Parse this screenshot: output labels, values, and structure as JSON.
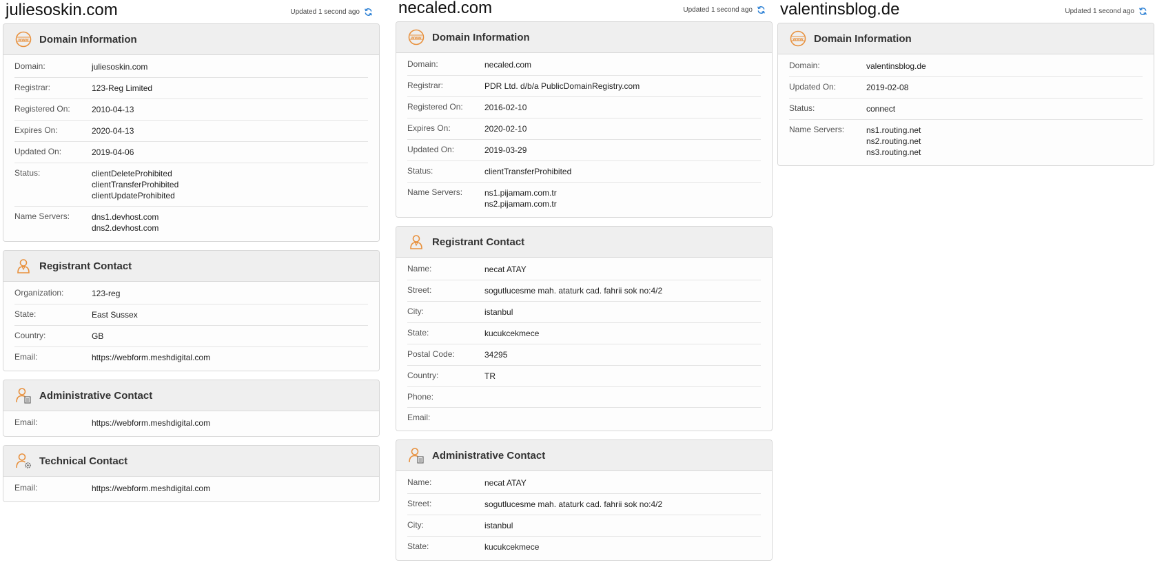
{
  "colors": {
    "accent": "#e8903c",
    "refresh": "#2a7fd4",
    "header_bg": "#efefef",
    "border": "#d6d6d6"
  },
  "updated_label": "Updated 1 second ago",
  "columns": [
    {
      "domain": "juliesoskin.com",
      "cards": [
        {
          "icon": "www-globe-icon",
          "title": "Domain Information",
          "rows": [
            {
              "label": "Domain:",
              "values": [
                "juliesoskin.com"
              ]
            },
            {
              "label": "Registrar:",
              "values": [
                "123-Reg Limited"
              ]
            },
            {
              "label": "Registered On:",
              "values": [
                "2010-04-13"
              ]
            },
            {
              "label": "Expires On:",
              "values": [
                "2020-04-13"
              ]
            },
            {
              "label": "Updated On:",
              "values": [
                "2019-04-06"
              ]
            },
            {
              "label": "Status:",
              "values": [
                "clientDeleteProhibited",
                "clientTransferProhibited",
                "clientUpdateProhibited"
              ]
            },
            {
              "label": "Name Servers:",
              "values": [
                "dns1.devhost.com",
                "dns2.devhost.com"
              ]
            }
          ]
        },
        {
          "icon": "person-icon",
          "title": "Registrant Contact",
          "rows": [
            {
              "label": "Organization:",
              "values": [
                "123-reg"
              ]
            },
            {
              "label": "State:",
              "values": [
                "East Sussex"
              ]
            },
            {
              "label": "Country:",
              "values": [
                "GB"
              ]
            },
            {
              "label": "Email:",
              "values": [
                "https://webform.meshdigital.com"
              ]
            }
          ]
        },
        {
          "icon": "person-clipboard-icon",
          "title": "Administrative Contact",
          "rows": [
            {
              "label": "Email:",
              "values": [
                "https://webform.meshdigital.com"
              ]
            }
          ]
        },
        {
          "icon": "person-gear-icon",
          "title": "Technical Contact",
          "rows": [
            {
              "label": "Email:",
              "values": [
                "https://webform.meshdigital.com"
              ]
            }
          ]
        }
      ]
    },
    {
      "domain": "necaled.com",
      "cards": [
        {
          "icon": "www-globe-icon",
          "title": "Domain Information",
          "rows": [
            {
              "label": "Domain:",
              "values": [
                "necaled.com"
              ]
            },
            {
              "label": "Registrar:",
              "values": [
                "PDR Ltd. d/b/a PublicDomainRegistry.com"
              ]
            },
            {
              "label": "Registered On:",
              "values": [
                "2016-02-10"
              ]
            },
            {
              "label": "Expires On:",
              "values": [
                "2020-02-10"
              ]
            },
            {
              "label": "Updated On:",
              "values": [
                "2019-03-29"
              ]
            },
            {
              "label": "Status:",
              "values": [
                "clientTransferProhibited"
              ]
            },
            {
              "label": "Name Servers:",
              "values": [
                "ns1.pijamam.com.tr",
                "ns2.pijamam.com.tr"
              ]
            }
          ]
        },
        {
          "icon": "person-icon",
          "title": "Registrant Contact",
          "rows": [
            {
              "label": "Name:",
              "values": [
                "necat ATAY"
              ]
            },
            {
              "label": "Street:",
              "values": [
                "sogutlucesme mah. ataturk cad. fahrii sok no:4/2"
              ]
            },
            {
              "label": "City:",
              "values": [
                "istanbul"
              ]
            },
            {
              "label": "State:",
              "values": [
                "kucukcekmece"
              ]
            },
            {
              "label": "Postal Code:",
              "values": [
                "34295"
              ]
            },
            {
              "label": "Country:",
              "values": [
                "TR"
              ]
            },
            {
              "label": "Phone:",
              "values": [
                ""
              ]
            },
            {
              "label": "Email:",
              "values": [
                ""
              ]
            }
          ]
        },
        {
          "icon": "person-clipboard-icon",
          "title": "Administrative Contact",
          "rows": [
            {
              "label": "Name:",
              "values": [
                "necat ATAY"
              ]
            },
            {
              "label": "Street:",
              "values": [
                "sogutlucesme mah. ataturk cad. fahrii sok no:4/2"
              ]
            },
            {
              "label": "City:",
              "values": [
                "istanbul"
              ]
            },
            {
              "label": "State:",
              "values": [
                "kucukcekmece"
              ]
            }
          ]
        }
      ]
    },
    {
      "domain": "valentinsblog.de",
      "cards": [
        {
          "icon": "www-globe-icon",
          "title": "Domain Information",
          "rows": [
            {
              "label": "Domain:",
              "values": [
                "valentinsblog.de"
              ]
            },
            {
              "label": "Updated On:",
              "values": [
                "2019-02-08"
              ]
            },
            {
              "label": "Status:",
              "values": [
                "connect"
              ]
            },
            {
              "label": "Name Servers:",
              "values": [
                "ns1.routing.net",
                "ns2.routing.net",
                "ns3.routing.net"
              ]
            }
          ]
        }
      ]
    }
  ]
}
